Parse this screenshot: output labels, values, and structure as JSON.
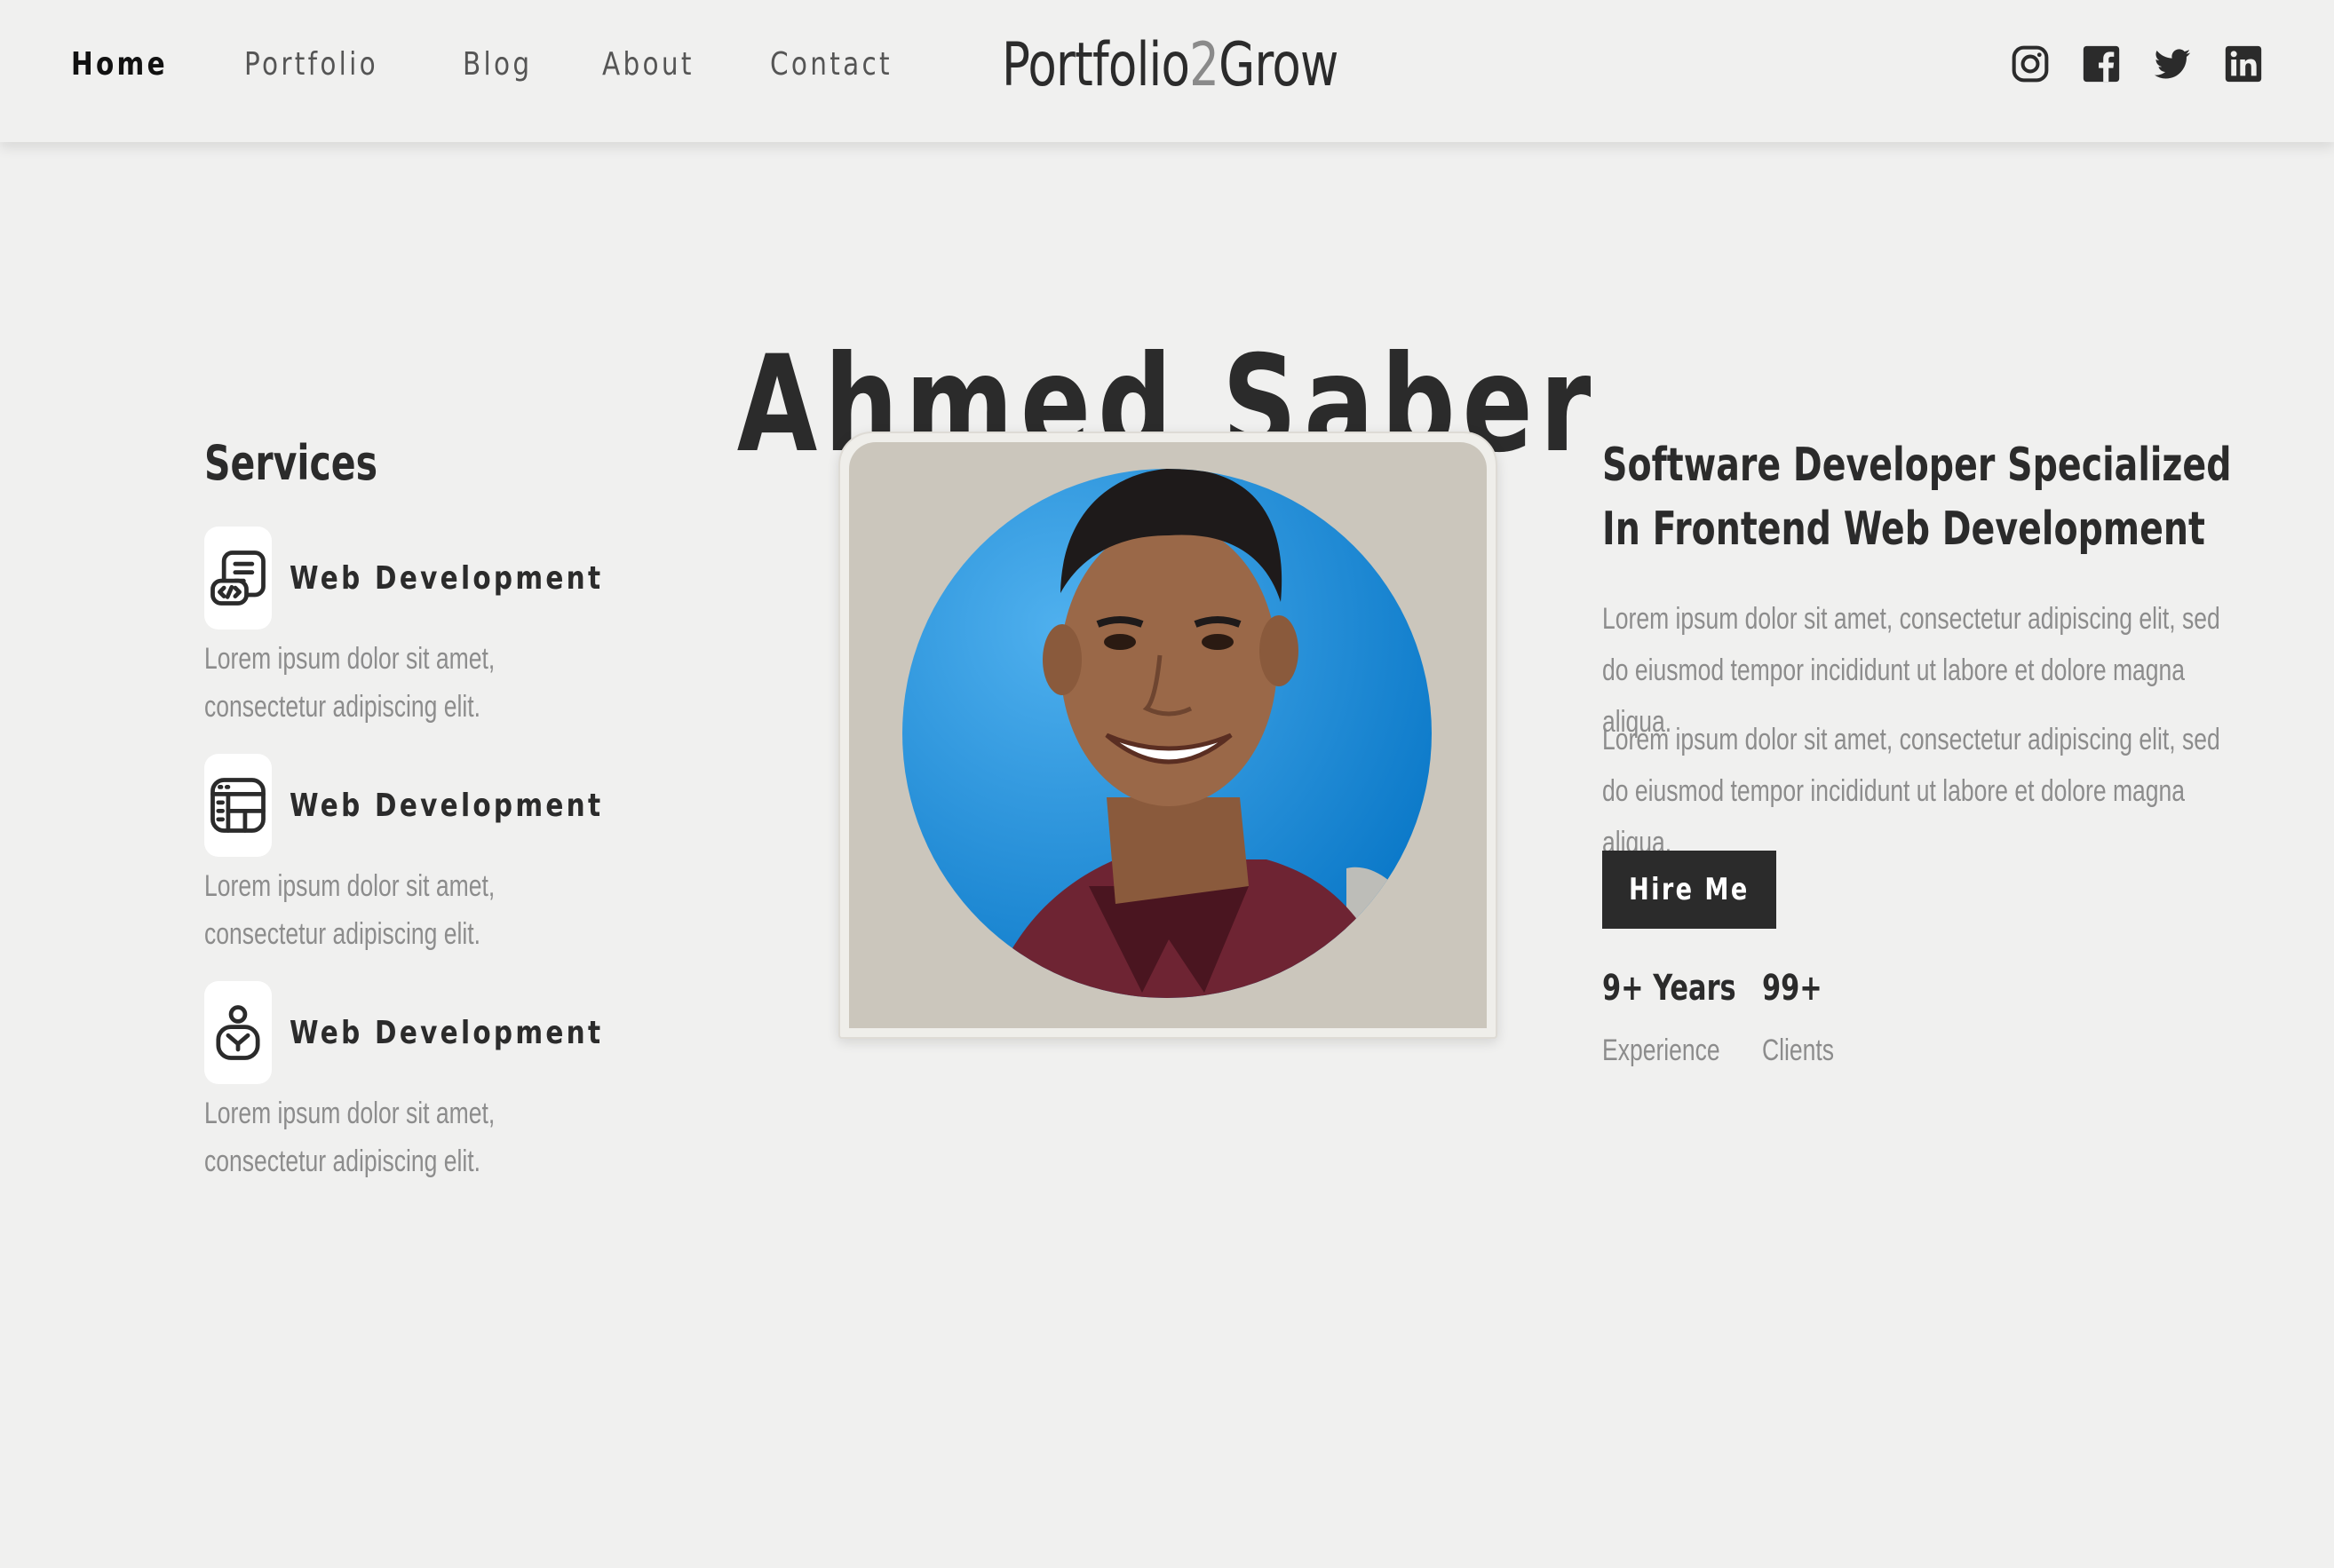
{
  "header": {
    "nav": [
      "Home",
      "Portfolio",
      "Blog",
      "About",
      "Contact"
    ],
    "active_nav": "Home",
    "logo_part1": "Portfolio",
    "logo_accent": "2",
    "logo_part2": "Grow",
    "socials": [
      "instagram-icon",
      "facebook-icon",
      "twitter-icon",
      "linkedin-icon"
    ]
  },
  "hero": {
    "name": "Ahmed Saber"
  },
  "services": {
    "heading": "Services",
    "items": [
      {
        "icon": "code-document-icon",
        "title": "Web Development",
        "desc": "Lorem ipsum dolor sit amet, consectetur adipiscing elit."
      },
      {
        "icon": "layout-grid-icon",
        "title": "Web Development",
        "desc": "Lorem ipsum dolor sit amet, consectetur adipiscing elit."
      },
      {
        "icon": "user-badge-icon",
        "title": "Web Development",
        "desc": "Lorem ipsum dolor sit amet, consectetur adipiscing elit."
      }
    ]
  },
  "about": {
    "headline": "Software Developer Specialized In Frontend Web Development",
    "para1": "Lorem ipsum dolor sit amet, consectetur adipiscing elit, sed do eiusmod tempor incididunt ut labore et dolore magna aliqua.",
    "para2": "Lorem ipsum dolor sit amet, consectetur adipiscing elit, sed do eiusmod tempor incididunt ut labore et dolore magna aliqua.",
    "cta": "Hire Me",
    "stats": [
      {
        "value": "9+ Years",
        "label": "Experience"
      },
      {
        "value": "99+",
        "label": "Clients"
      }
    ]
  },
  "colors": {
    "background": "#f0f0ef",
    "text": "#2b2b2b",
    "muted": "#8c8c8c",
    "portrait_circle": "#1a8fd8"
  }
}
